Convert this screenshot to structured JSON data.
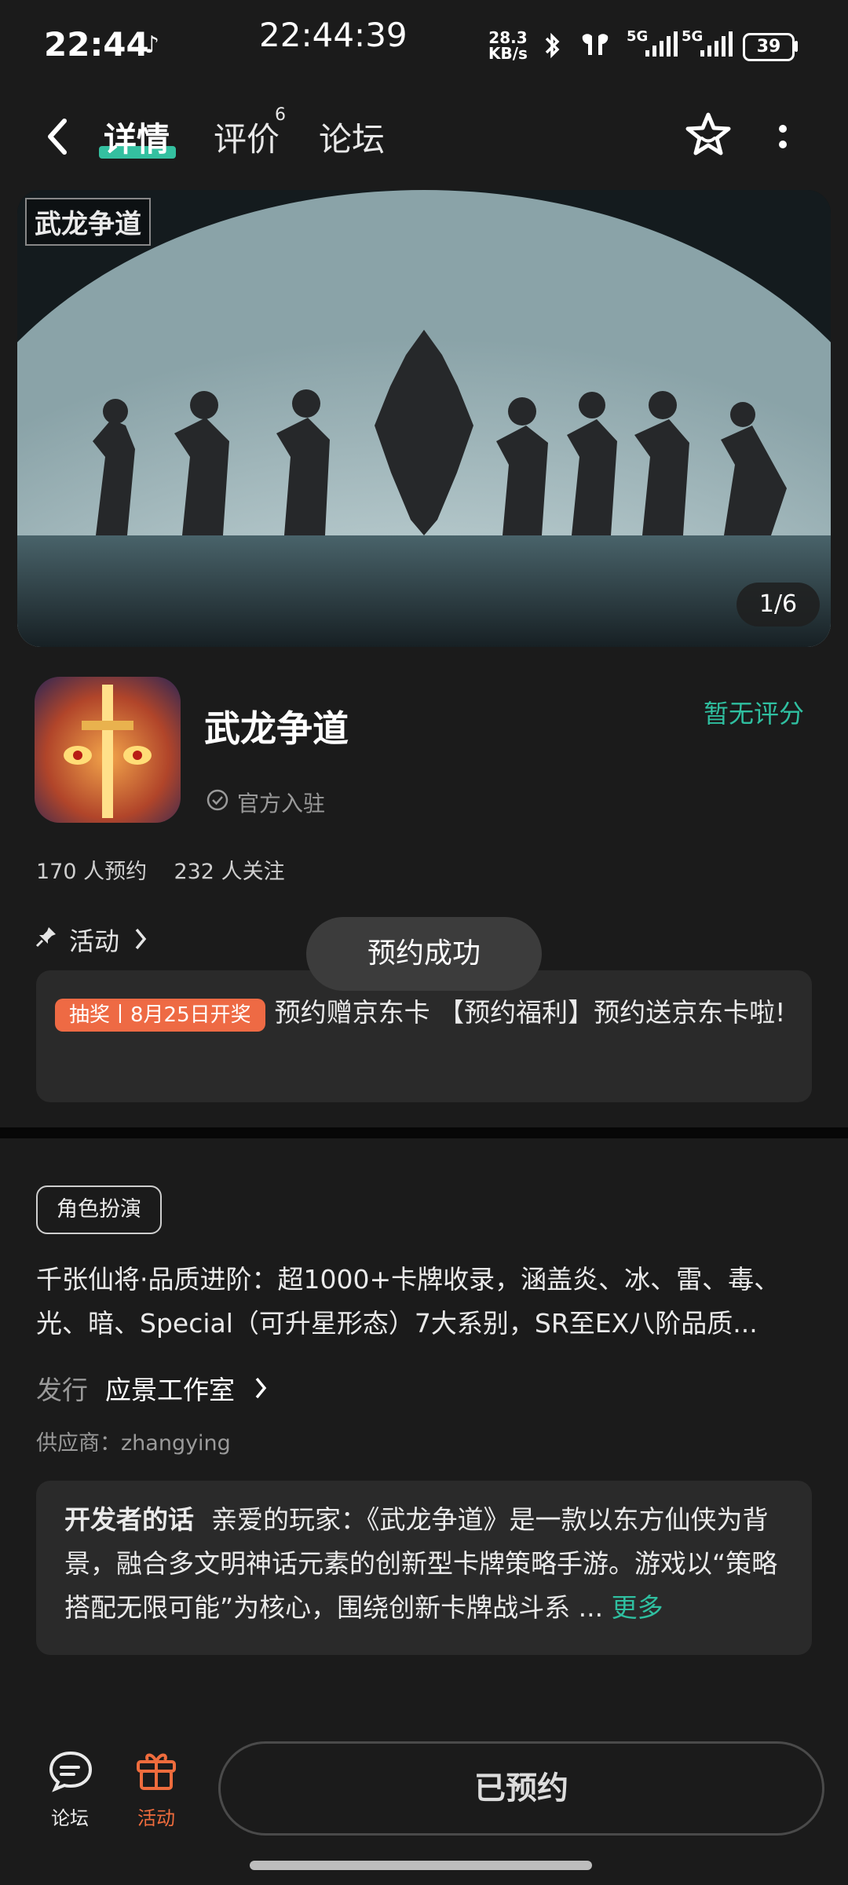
{
  "status_bar": {
    "time_left": "22:44",
    "time_center": "22:44:39",
    "net_speed_value": "28.3",
    "net_speed_unit": "KB/s",
    "signal1": "5G",
    "signal2": "5G",
    "battery": "39"
  },
  "header": {
    "tabs": [
      {
        "label": "详情"
      },
      {
        "label": "评价",
        "badge": "6"
      },
      {
        "label": "论坛"
      }
    ]
  },
  "banner": {
    "logo_text": "武龙争道",
    "page_indicator": "1/6"
  },
  "app": {
    "name": "武龙争道",
    "official_label": "官方入驻",
    "rating_text": "暂无评分",
    "stats": "170 人预约    232 人关注"
  },
  "activity": {
    "title": "活动",
    "tag": "抽奖丨8月25日开奖",
    "text": "预约赠京东卡 【预约福利】预约送京东卡啦!"
  },
  "toast": "预约成功",
  "details": {
    "genre_tag": "角色扮演",
    "description": "千张仙将·品质进阶：超1000+卡牌收录，涵盖炎、冰、雷、毒、光、暗、Special（可升星形态）7大系别，SR至EX八阶品质...",
    "publisher_label": "发行",
    "publisher_value": "应景工作室",
    "supplier": "供应商：zhangying",
    "dev_label": "开发者的话",
    "dev_text": "亲爱的玩家：《武龙争道》是一款以东方仙侠为背景，融合多文明神话元素的创新型卡牌策略手游。游戏以“策略搭配无限可能”为核心，围绕创新卡牌战斗系 ...",
    "dev_more": "更多"
  },
  "bottom_bar": {
    "forum_label": "论坛",
    "activity_label": "活动",
    "reserved_label": "已预约"
  },
  "colors": {
    "accent_green": "#2fbfa0",
    "accent_orange": "#ef6c3d",
    "background": "#1b1b1b"
  }
}
